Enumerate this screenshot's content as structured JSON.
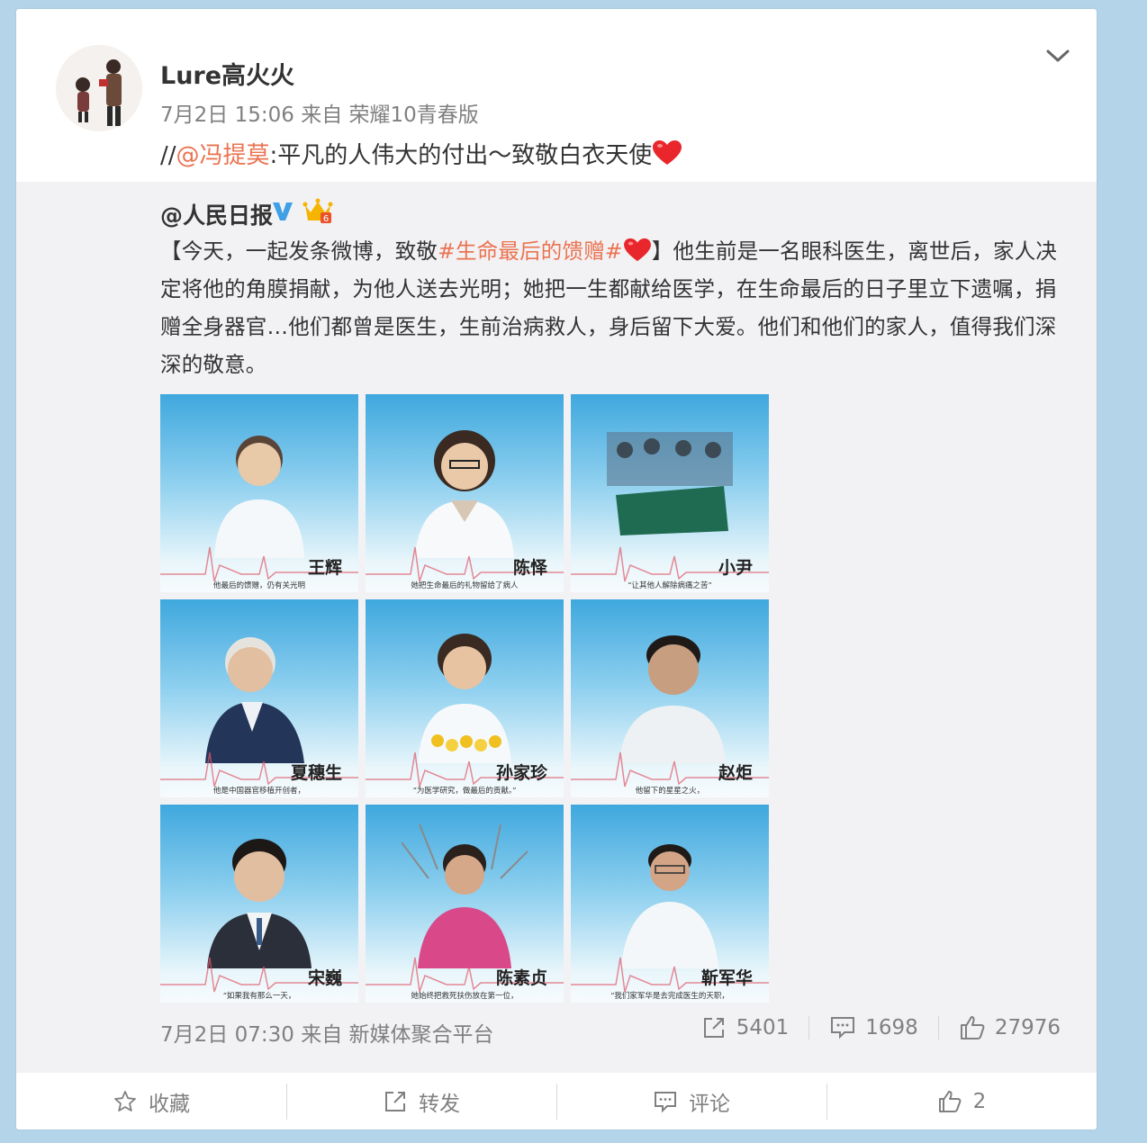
{
  "post": {
    "username": "Lure高火火",
    "timestamp": "7月2日 15:06",
    "from_label": "来自",
    "source": "荣耀10青春版",
    "repost_prefix": "//",
    "mention": "@冯提莫",
    "repost_body": ":平凡的人伟大的付出～致敬白衣天使"
  },
  "quoted": {
    "author": "@人民日报",
    "text_part1": "【今天，一起发条微博，致敬",
    "hashtag": "#生命最后的馈赠#",
    "text_part2": "】他生前是一名眼科医生，离世后，家人决定将他的角膜捐献，为他人送去光明；她把一生都献给医学，在生命最后的日子里立下遗嘱，捐赠全身器官…他们都曾是医生，生前治病救人，身后留下大爱。他们和他们的家人，值得我们深深的敬意。",
    "images": [
      {
        "name": "王辉",
        "caption": "他最后的馈赠，仍有关光明"
      },
      {
        "name": "陈怿",
        "caption": "她把生命最后的礼物留给了病人"
      },
      {
        "name": "小尹",
        "caption": "“让其他人解除病痛之苦”"
      },
      {
        "name": "夏穗生",
        "caption": "他是中国器官移植开创者，"
      },
      {
        "name": "孙家珍",
        "caption": "“为医学研究，做最后的贡献。”"
      },
      {
        "name": "赵炬",
        "caption": "他留下的星星之火，"
      },
      {
        "name": "宋巍",
        "caption": "“如果我有那么一天，"
      },
      {
        "name": "陈素贞",
        "caption": "她始终把救死扶伤放在第一位，"
      },
      {
        "name": "靳军华",
        "caption": "“我们家军华是去完成医生的天职，"
      }
    ],
    "footer_time": "7月2日 07:30",
    "footer_from": "来自",
    "footer_source": "新媒体聚合平台",
    "repost_count": "5401",
    "comment_count": "1698",
    "like_count": "27976"
  },
  "actions": {
    "favorite": "收藏",
    "repost": "转发",
    "comment": "评论",
    "like_count": "2"
  },
  "colors": {
    "link": "#eb7350",
    "verified": "#3fa0e6",
    "heart": "#e8262b",
    "crown": "#f5b400"
  }
}
